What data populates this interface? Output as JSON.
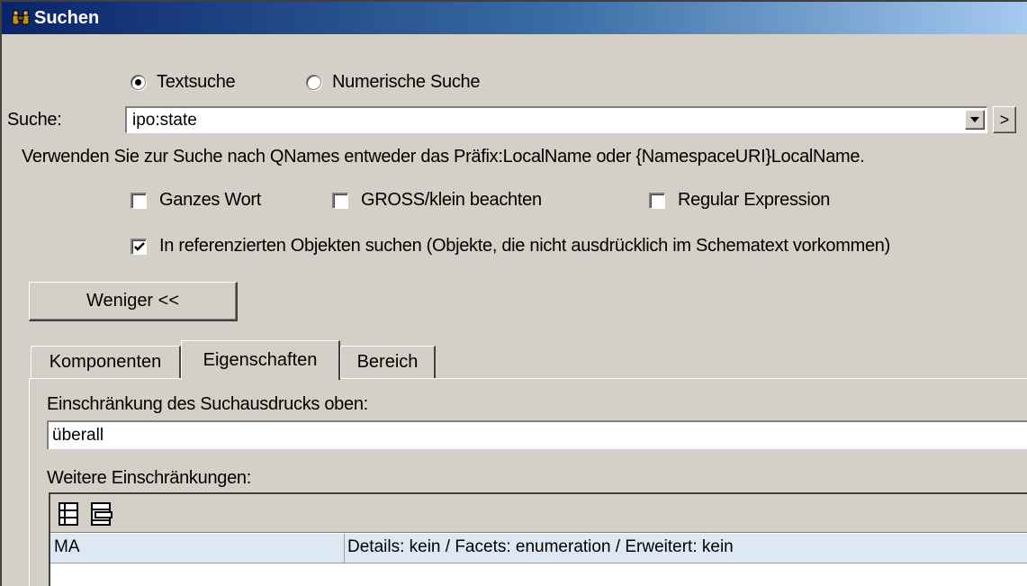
{
  "window": {
    "title": "Suchen"
  },
  "search_mode": {
    "text_label": "Textsuche",
    "numeric_label": "Numerische Suche",
    "selected": "text"
  },
  "search": {
    "label": "Suche:",
    "value": "ipo:state",
    "hint": "Verwenden Sie zur Suche nach QNames entweder das Präfix:LocalName oder {NamespaceURI}LocalName.",
    "go_label": ">"
  },
  "options": {
    "whole_word": {
      "label": "Ganzes Wort",
      "checked": false
    },
    "match_case": {
      "label": "GROSS/klein beachten",
      "checked": false
    },
    "regex": {
      "label": "Regular Expression",
      "checked": false
    },
    "referenced": {
      "label": "In referenzierten Objekten suchen (Objekte, die nicht ausdrücklich im Schematext vorkommen)",
      "checked": true
    }
  },
  "less_button": {
    "label": "Weniger <<"
  },
  "tabs": [
    {
      "label": "Komponenten",
      "active": false
    },
    {
      "label": "Eigenschaften",
      "active": true
    },
    {
      "label": "Bereich",
      "active": false
    }
  ],
  "properties": {
    "restriction_label": "Einschränkung des Suchausdrucks oben:",
    "restriction_value": "überall",
    "more_label": "Weitere Einschränkungen:",
    "rows": [
      {
        "name": "MA",
        "details": "Details: kein / Facets: enumeration / Erweitert: kein"
      }
    ]
  }
}
